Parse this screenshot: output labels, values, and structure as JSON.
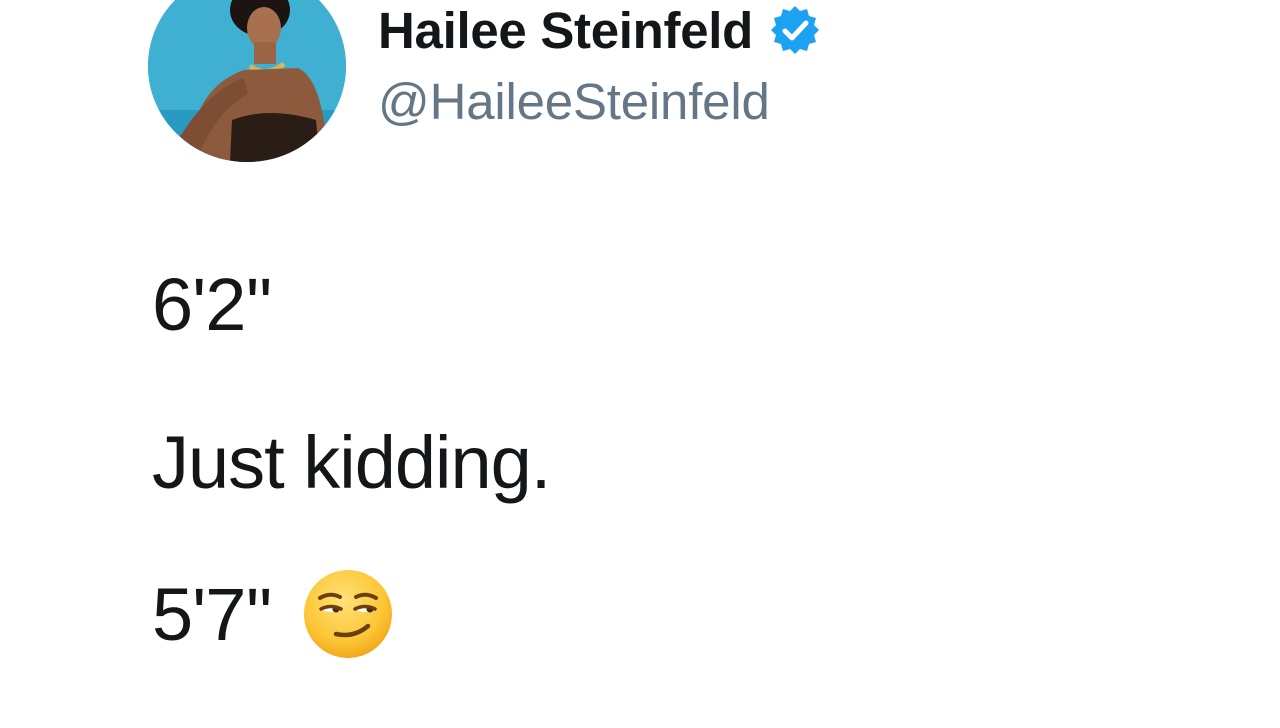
{
  "author": {
    "display_name": "Hailee Steinfeld",
    "handle": "@HaileeSteinfeld",
    "verified": true,
    "verified_color": "#1da1f2",
    "avatar_icon": "profile-photo"
  },
  "tweet": {
    "lines": [
      "6'2''",
      "Just kidding.",
      "5'7''"
    ],
    "emoji": "smirking-face"
  },
  "colors": {
    "name": "#14171a",
    "handle": "#657786",
    "body": "#14171a"
  }
}
